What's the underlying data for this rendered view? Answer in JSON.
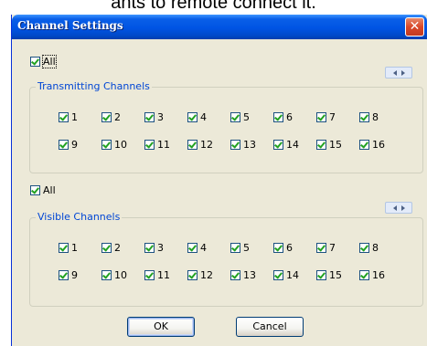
{
  "background_caption": "ants to remote connect it.",
  "dialog": {
    "title": "Channel Settings",
    "close_glyph": "✕"
  },
  "transmitting": {
    "all_label": "All",
    "all_checked": true,
    "group_label": "Transmitting Channels",
    "channels": [
      {
        "label": "1",
        "checked": true
      },
      {
        "label": "2",
        "checked": true
      },
      {
        "label": "3",
        "checked": true
      },
      {
        "label": "4",
        "checked": true
      },
      {
        "label": "5",
        "checked": true
      },
      {
        "label": "6",
        "checked": true
      },
      {
        "label": "7",
        "checked": true
      },
      {
        "label": "8",
        "checked": true
      },
      {
        "label": "9",
        "checked": true
      },
      {
        "label": "10",
        "checked": true
      },
      {
        "label": "11",
        "checked": true
      },
      {
        "label": "12",
        "checked": true
      },
      {
        "label": "13",
        "checked": true
      },
      {
        "label": "14",
        "checked": true
      },
      {
        "label": "15",
        "checked": true
      },
      {
        "label": "16",
        "checked": true
      }
    ]
  },
  "visible": {
    "all_label": "All",
    "all_checked": true,
    "group_label": "Visible Channels",
    "channels": [
      {
        "label": "1",
        "checked": true
      },
      {
        "label": "2",
        "checked": true
      },
      {
        "label": "3",
        "checked": true
      },
      {
        "label": "4",
        "checked": true
      },
      {
        "label": "5",
        "checked": true
      },
      {
        "label": "6",
        "checked": true
      },
      {
        "label": "7",
        "checked": true
      },
      {
        "label": "8",
        "checked": true
      },
      {
        "label": "9",
        "checked": true
      },
      {
        "label": "10",
        "checked": true
      },
      {
        "label": "11",
        "checked": true
      },
      {
        "label": "12",
        "checked": true
      },
      {
        "label": "13",
        "checked": true
      },
      {
        "label": "14",
        "checked": true
      },
      {
        "label": "15",
        "checked": true
      },
      {
        "label": "16",
        "checked": true
      }
    ]
  },
  "buttons": {
    "ok": "OK",
    "cancel": "Cancel"
  },
  "colors": {
    "titlebar": "#0054e3",
    "dialog_bg": "#ece9d8",
    "group_label": "#0046d5",
    "check": "#21a121",
    "close_button": "#d9482a"
  }
}
